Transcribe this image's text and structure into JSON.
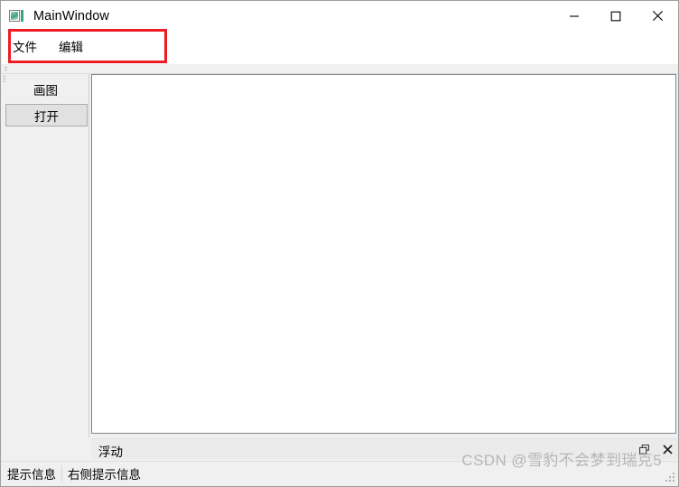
{
  "window": {
    "title": "MainWindow",
    "icon": "picture-icon",
    "controls": {
      "minimize": "minimize-icon",
      "maximize": "maximize-icon",
      "close": "close-icon"
    }
  },
  "menubar": {
    "items": [
      {
        "label": "文件"
      },
      {
        "label": "编辑"
      }
    ]
  },
  "annotation": {
    "color": "#ee1c25",
    "target": "menubar"
  },
  "left_dock": {
    "title": "画图",
    "buttons": [
      {
        "label": "打开"
      }
    ]
  },
  "canvas": {
    "content": ""
  },
  "bottom_dock": {
    "title": "浮动",
    "buttons": [
      {
        "name": "float-icon"
      },
      {
        "name": "close-icon"
      }
    ]
  },
  "statusbar": {
    "items": [
      {
        "label": "提示信息"
      },
      {
        "label": "右侧提示信息"
      }
    ]
  },
  "watermark": {
    "text": "CSDN @雪豹不会梦到瑞克5"
  }
}
